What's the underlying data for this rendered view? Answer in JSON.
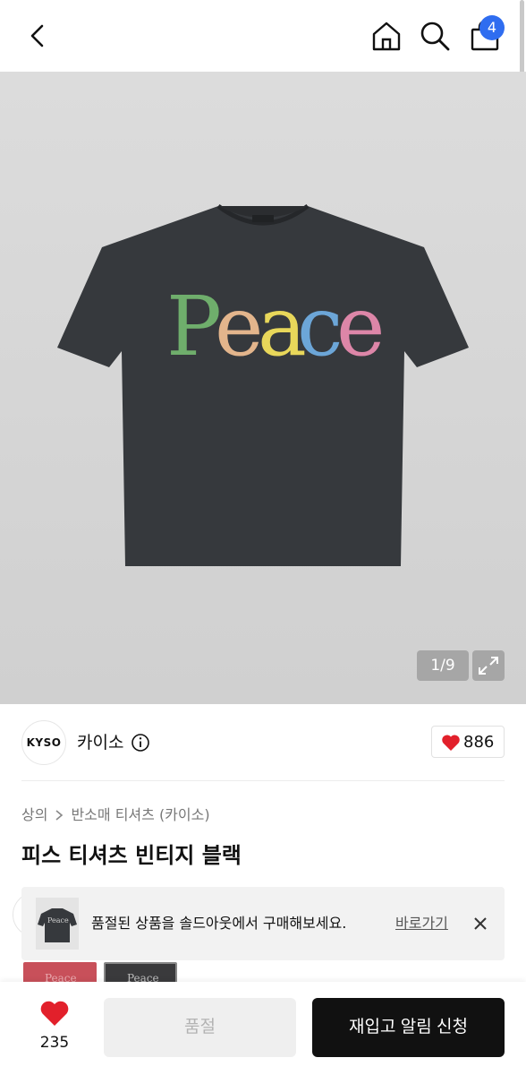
{
  "header": {
    "cart_count": "4",
    "icons": [
      "back-arrow-icon",
      "home-icon",
      "search-icon",
      "shopping-bag-icon"
    ]
  },
  "hero": {
    "print_text": "Peace",
    "pager": "1/9"
  },
  "brand": {
    "logo_text": "KYSO",
    "name": "카이소",
    "like_count": "886"
  },
  "breadcrumb": {
    "category": "상의",
    "subcategory": "반소매 티셔츠 (카이소)"
  },
  "product": {
    "title": "피스 티셔츠 빈티지 블랙"
  },
  "soldout_banner": {
    "message": "품절된 상품을 솔드아웃에서 구매해보세요.",
    "link": "바로가기"
  },
  "bottom_bar": {
    "like_count": "235",
    "soldout_label": "품절",
    "restock_label": "재입고 알림 신청"
  },
  "colors": {
    "accent_blue": "#2f6df0",
    "heart_red": "#e2202b",
    "shirt": "#36393d"
  }
}
